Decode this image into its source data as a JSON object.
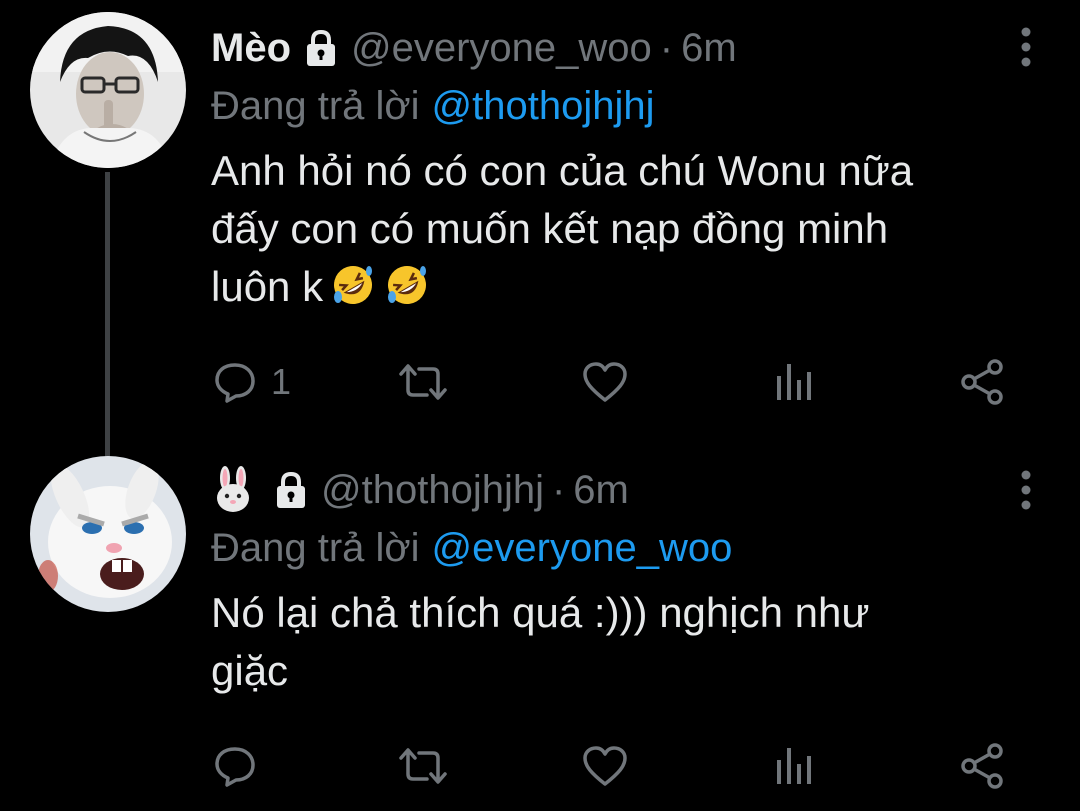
{
  "tweets": [
    {
      "display_name": "Mèo",
      "handle": "@everyone_woo",
      "separator": "·",
      "time": "6m",
      "reply_prefix": "Đang trả lời",
      "reply_to": "@thothojhjhj",
      "text": "Anh hỏi nó có con của chú Wonu nữa\nđấy con có muốn kết nạp đồng minh\nluôn k",
      "text_emojis": [
        "rolling-on-floor-laughing",
        "rolling-on-floor-laughing"
      ],
      "reply_count": "1",
      "protected": true
    },
    {
      "display_name": "",
      "display_name_emoji": "rabbit-face",
      "handle": "@thothojhjhj",
      "separator": "·",
      "time": "6m",
      "reply_prefix": "Đang trả lời",
      "reply_to": "@everyone_woo",
      "text": "Nó lại chả thích quá :))) nghịch như\ngiặc",
      "reply_count": "",
      "protected": true
    }
  ],
  "colors": {
    "background": "#000000",
    "primary_text": "#e7e9ea",
    "secondary_text": "#71767b",
    "link": "#1d9bf0",
    "thread_line": "#3e4144"
  },
  "icons": {
    "lock": "lock-icon",
    "more": "more-vertical-icon",
    "reply": "reply-icon",
    "retweet": "retweet-icon",
    "like": "heart-icon",
    "stats": "stats-icon",
    "share": "share-icon"
  }
}
